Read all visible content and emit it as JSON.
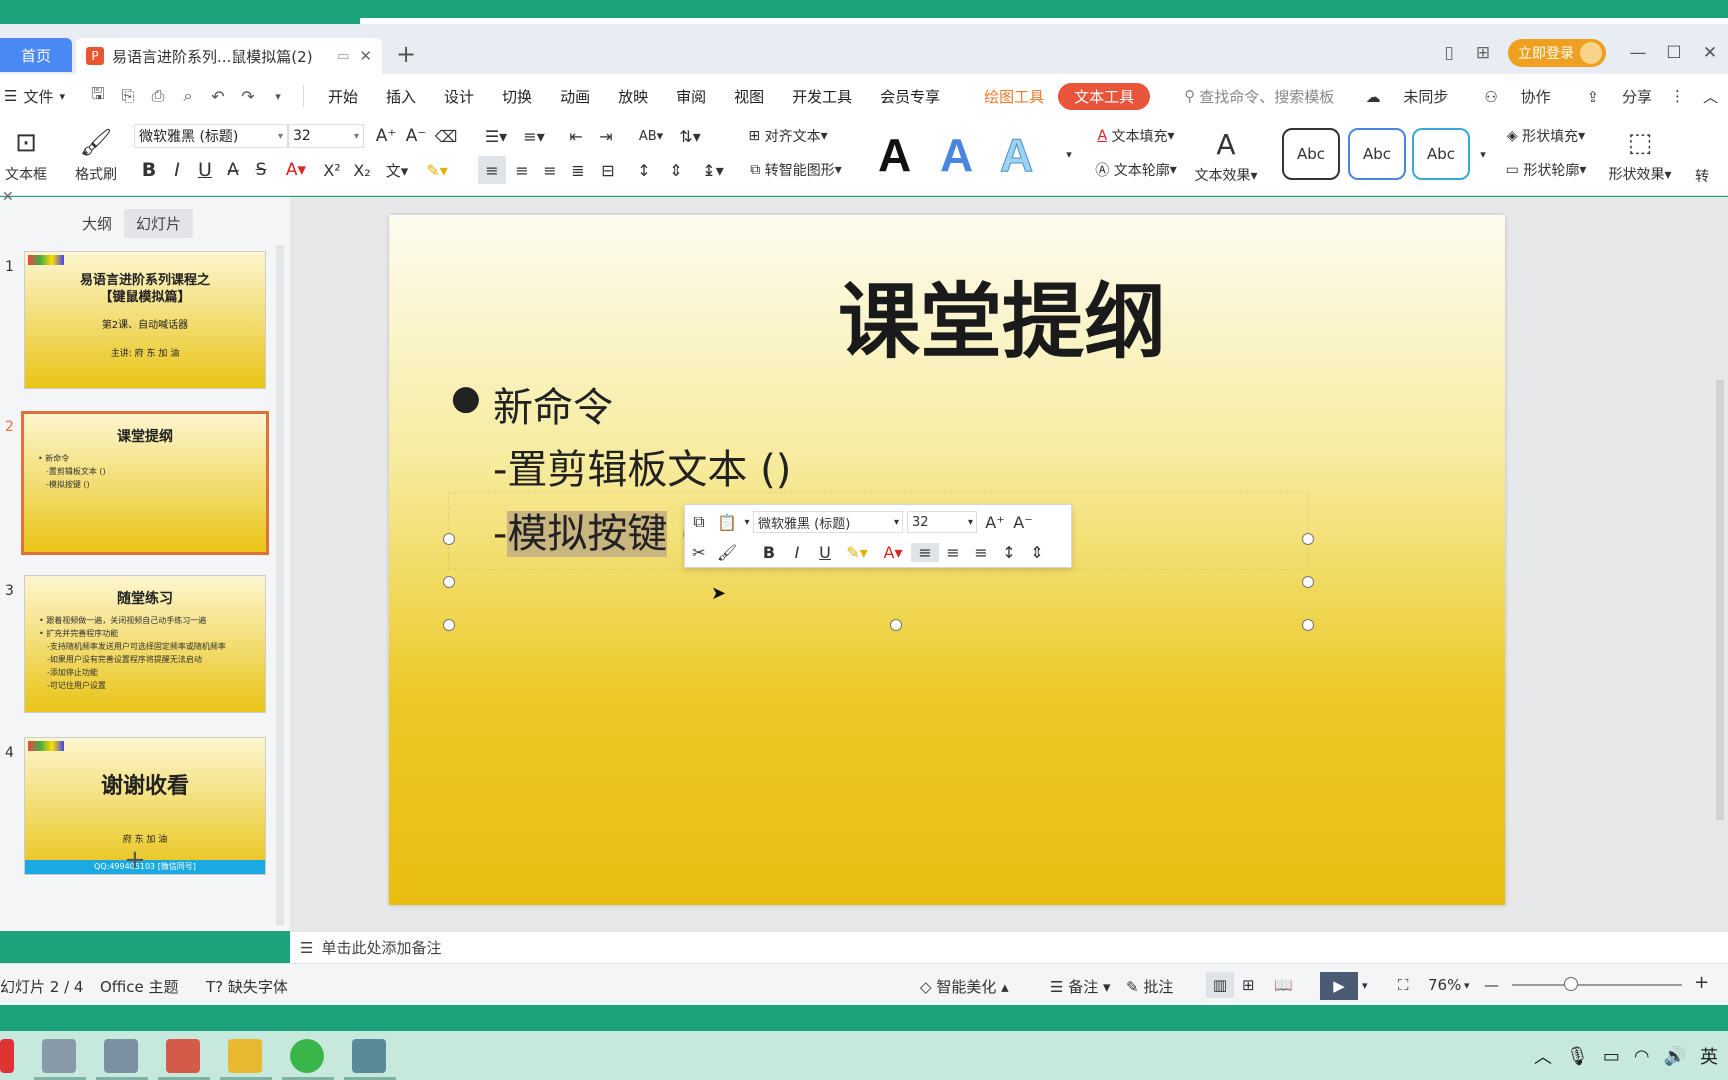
{
  "app": {
    "home_tab": "首页",
    "doc_tab": "易语言进阶系列...鼠模拟篇(2)",
    "login": "立即登录"
  },
  "menu": {
    "file": "文件",
    "items": [
      "开始",
      "插入",
      "设计",
      "切换",
      "动画",
      "放映",
      "审阅",
      "视图",
      "开发工具",
      "会员专享"
    ],
    "drawing_tools": "绘图工具",
    "text_tools": "文本工具",
    "search": "查找命令、搜索模板",
    "sync": "未同步",
    "collab": "协作",
    "share": "分享"
  },
  "ribbon": {
    "textbox": "文本框",
    "format_painter": "格式刷",
    "font_name": "微软雅黑 (标题)",
    "font_size": "32",
    "align_text": "对齐文本",
    "smart_shape": "转智能图形",
    "text_fill": "文本填充",
    "text_outline": "文本轮廓",
    "text_effect": "文本效果",
    "shape_fill": "形状填充",
    "shape_outline": "形状轮廓",
    "shape_effect": "形状效果",
    "style_abc": "Abc",
    "convert": "转",
    "style_a": "A"
  },
  "panel": {
    "tab_outline": "大纲",
    "tab_slides": "幻灯片"
  },
  "slides": [
    {
      "num": "1",
      "title": "易语言进阶系列课程之\n【键鼠模拟篇】",
      "lines": [
        "第2课、自动喊话器",
        "主讲: 府 东 加 油"
      ]
    },
    {
      "num": "2",
      "title": "课堂提纲",
      "lines": [
        "• 新命令",
        "-置剪辑板文本 ()",
        "-模拟按键 ()"
      ]
    },
    {
      "num": "3",
      "title": "随堂练习",
      "lines": [
        "• 跟着视频做一遍，关闭视频自己动手练习一遍",
        "• 扩充并完善程序功能",
        "-支持随机频率发送用户可选择固定频率或随机频率",
        "-如果用户没有完善设置程序将提醒无法启动",
        "-添加停止功能",
        "-可记住用户设置"
      ]
    },
    {
      "num": "4",
      "title": "谢谢收看",
      "lines": [
        "府 东 加 油"
      ],
      "footer": "QQ:499405103 [微信同号]"
    }
  ],
  "slide": {
    "title": "课堂提纲",
    "bullet": "新命令",
    "line1": "-置剪辑板文本 ()",
    "line2_prefix": "-",
    "line2_highlight": "模拟按键",
    "line2_suffix": " ()"
  },
  "notes": "单击此处添加备注",
  "status": {
    "slide_counter": "幻灯片 2 / 4",
    "theme": "Office 主题",
    "missing_font": "缺失字体",
    "beautify": "智能美化",
    "notes": "备注",
    "comment": "批注",
    "zoom": "76%"
  },
  "tray": {
    "ime": "英"
  }
}
